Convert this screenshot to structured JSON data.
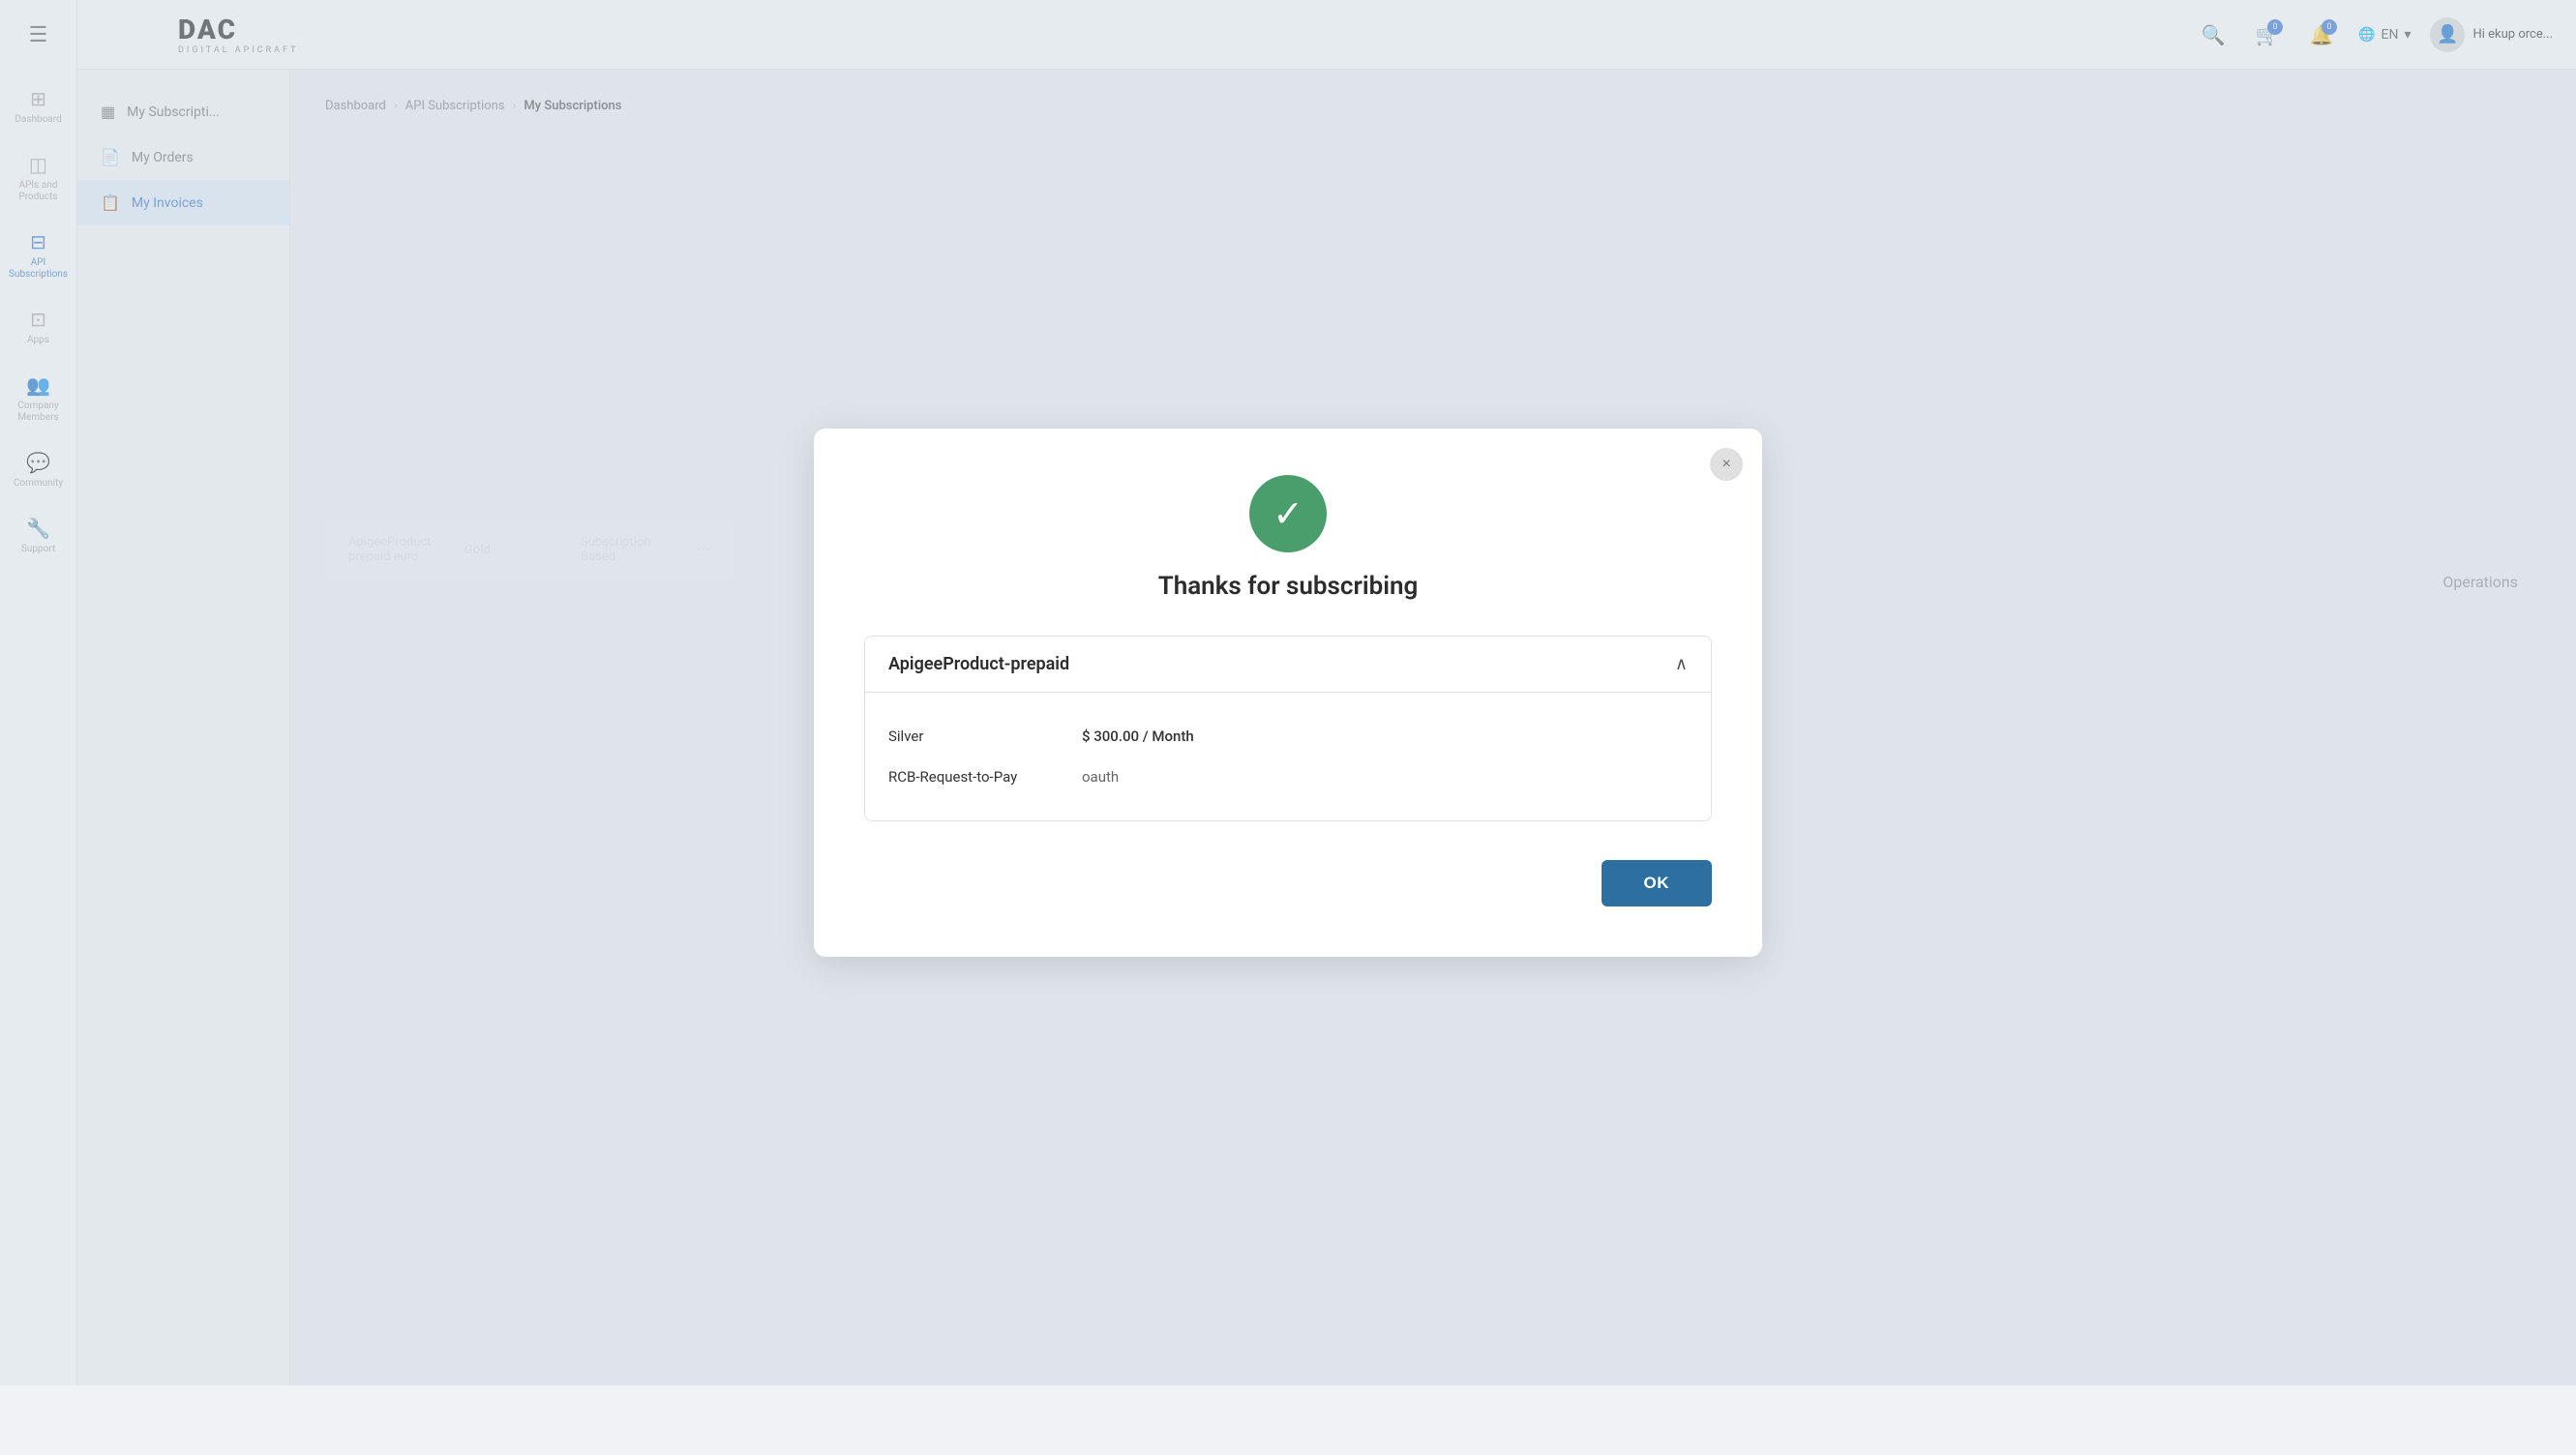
{
  "app": {
    "logo_text": "DAC",
    "logo_sub": "Digital APIcraft"
  },
  "header": {
    "search_placeholder": "Search",
    "cart_badge": "0",
    "notif_badge": "0",
    "lang": "EN",
    "user_name": "Hi ekup orce..."
  },
  "sidebar": {
    "items": [
      {
        "id": "dashboard",
        "label": "Dashboard",
        "icon": "⊞"
      },
      {
        "id": "apis-products",
        "label": "APIs and Products",
        "icon": "◫"
      },
      {
        "id": "api-subscriptions",
        "label": "API Subscriptions",
        "icon": "⊟",
        "active": true
      },
      {
        "id": "apps",
        "label": "Apps",
        "icon": "⊡"
      },
      {
        "id": "company-members",
        "label": "Company Members",
        "icon": "👥"
      },
      {
        "id": "community",
        "label": "Community",
        "icon": "💬"
      },
      {
        "id": "support",
        "label": "Support",
        "icon": "🔧"
      }
    ]
  },
  "sub_sidebar": {
    "items": [
      {
        "id": "my-subscriptions",
        "label": "My Subscriptions",
        "icon": "▦"
      },
      {
        "id": "my-orders",
        "label": "My Orders",
        "icon": "📄"
      },
      {
        "id": "my-invoices",
        "label": "My Invoices",
        "icon": "📋",
        "active": true
      }
    ]
  },
  "breadcrumb": {
    "items": [
      {
        "label": "Dashboard",
        "active": false
      },
      {
        "label": "API Subscriptions",
        "active": false
      },
      {
        "label": "My Subscriptions",
        "active": true
      }
    ]
  },
  "modal": {
    "close_label": "×",
    "check_icon": "✓",
    "title": "Thanks for subscribing",
    "card": {
      "title": "ApigeeProduct-prepaid",
      "rows": [
        {
          "label": "Silver",
          "value": "$ 300.00 / Month"
        },
        {
          "label": "RCB-Request-to-Pay",
          "value": "oauth"
        }
      ]
    },
    "ok_label": "OK"
  },
  "background": {
    "table_row": {
      "product": "ApigeeProduct-prepaid euro",
      "tier": "Gold",
      "type": "Subscription Based"
    },
    "operations_label": "Operations"
  }
}
